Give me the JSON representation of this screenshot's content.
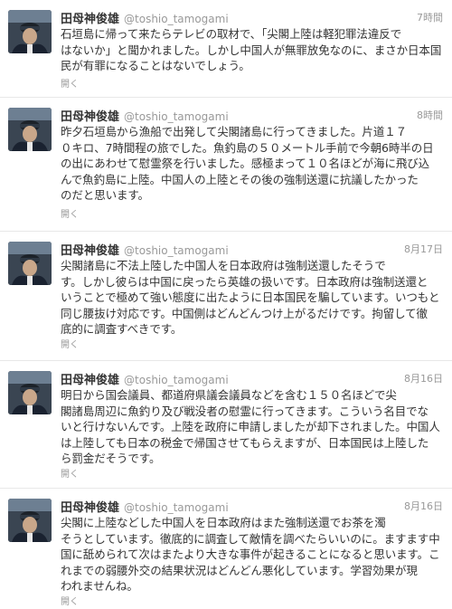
{
  "tweets": [
    {
      "name": "田母神俊雄",
      "handle": "@toshio_tamogami",
      "time": "7時間",
      "text": "石垣島に帰って来たらテレビの取材で、「尖閣上陸は軽犯罪法違反で\nはないか」と聞かれました。しかし中国人が無罪放免なのに、まさか日本国\n民が有罪になることはないでしょう。",
      "open_label": "開く"
    },
    {
      "name": "田母神俊雄",
      "handle": "@toshio_tamogami",
      "time": "8時間",
      "text": "昨夕石垣島から漁船で出発して尖閣諸島に行ってきました。片道１７\n０キロ、7時間程の旅でした。魚釣島の５０メートル手前で今朝6時半の日\nの出にあわせて慰霊祭を行いました。感極まって１０名ほどが海に飛び込\nんで魚釣島に上陸。中国人の上陸とその後の強制送還に抗議したかった\nのだと思います。",
      "open_label": "開く"
    },
    {
      "name": "田母神俊雄",
      "handle": "@toshio_tamogami",
      "time": "8月17日",
      "text": "尖閣諸島に不法上陸した中国人を日本政府は強制送還したそうで\nす。しかし彼らは中国に戻ったら英雄の扱いです。日本政府は強制送還と\nいうことで極めて強い態度に出たように日本国民を騙しています。いつもと\n同じ腰抜け対応です。中国側はどんどんつけ上がるだけです。拘留して徹\n底的に調査すべきです。",
      "open_label": "開く"
    },
    {
      "name": "田母神俊雄",
      "handle": "@toshio_tamogami",
      "time": "8月16日",
      "text": "明日から国会議員、都道府県議会議員などを含む１５０名ほどで尖\n閣諸島周辺に魚釣り及び戦没者の慰霊に行ってきます。こういう名目でな\nいと行けないんです。上陸を政府に申請しましたが却下されました。中国人\nは上陸しても日本の税金で帰国させてもらえますが、日本国民は上陸した\nら罰金だそうです。",
      "open_label": "開く"
    },
    {
      "name": "田母神俊雄",
      "handle": "@toshio_tamogami",
      "time": "8月16日",
      "text": "尖閣に上陸などした中国人を日本政府はまた強制送還でお茶を濁\nそうとしています。徹底的に調査して敵情を調べたらいいのに。ますます中\n国に舐められて次はまたより大きな事件が起きることになると思います。こ\nれまでの弱腰外交の結果状況はどんどん悪化しています。学習効果が現\nわれませんね。",
      "open_label": "開く"
    }
  ]
}
